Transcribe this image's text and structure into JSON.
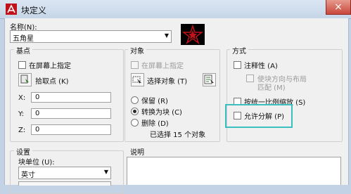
{
  "window": {
    "title": "块定义",
    "close_label": "×"
  },
  "name": {
    "label": "名称(N):",
    "value": "五角星"
  },
  "base_point": {
    "title": "基点",
    "specify_on_screen": "在屏幕上指定",
    "pick_point": "拾取点 (K)",
    "x_label": "X:",
    "x_value": "0",
    "y_label": "Y:",
    "y_value": "0",
    "z_label": "Z:",
    "z_value": "0"
  },
  "objects": {
    "title": "对象",
    "specify_on_screen": "在屏幕上指定",
    "select_objects": "选择对象 (T)",
    "retain": "保留 (R)",
    "convert_to_block": "转换为块 (C)",
    "delete": "删除 (D)",
    "selected_count": "已选择 15 个对象"
  },
  "behavior": {
    "title": "方式",
    "annotative": "注释性 (A)",
    "match_orientation_line1": "使块方向与布局",
    "match_orientation_line2": "匹配 (M)",
    "scale_uniformly": "按统一比例缩放 (S)",
    "allow_exploding": "允许分解 (P)"
  },
  "settings": {
    "title": "设置",
    "block_unit_label": "块单位 (U):",
    "block_unit_value": "英寸"
  },
  "description": {
    "title": "说明"
  },
  "colors": {
    "preview_star": "#c0121a",
    "highlight": "#3bbfbd"
  }
}
